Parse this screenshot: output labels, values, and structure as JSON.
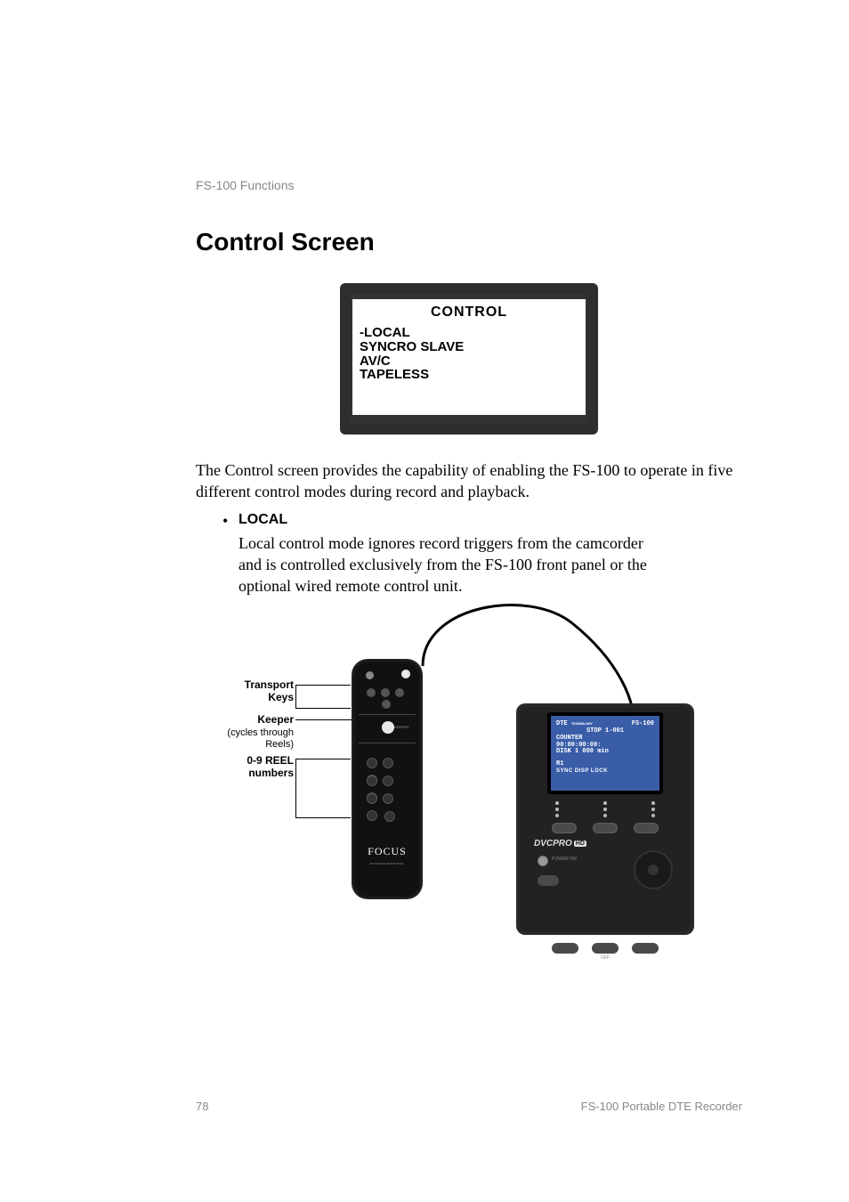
{
  "header": "FS-100 Functions",
  "title": "Control Screen",
  "lcd": {
    "title": "CONTROL",
    "lines": [
      "-LOCAL",
      " SYNCRO SLAVE",
      " AV/C",
      "TAPELESS"
    ]
  },
  "paragraph": "The Control screen provides the capability of enabling the FS-100 to operate in five different control modes during record and playback.",
  "bullet": {
    "label": "LOCAL",
    "body": "Local control mode ignores record triggers from the camcorder and is controlled exclusively from the FS-100 front panel or the optional wired remote control unit."
  },
  "callouts": {
    "transport": {
      "l1": "Transport",
      "l2": "Keys"
    },
    "keeper": {
      "l1": "Keeper",
      "l2": "(cycles through",
      "l3": "Reels)"
    },
    "reel": {
      "l1": "0-9 REEL",
      "l2": "numbers"
    }
  },
  "remote_logo": "FOCUS",
  "remote_logo_sub": "enhancements",
  "remote_keeper": "KEEPER",
  "fs100": {
    "brand": "DTE",
    "brand_sub": "TECHNOLOGY",
    "model": "FS-100",
    "status": "STOP  1-001",
    "counter_label": "COUNTER",
    "counter": "00:00:00:00:",
    "disk": "DISK 1   000 min",
    "r1": "R1",
    "softkeys": "SYNC  DISP  LOCK",
    "logo": "DVCPRO",
    "hd": "HD",
    "power": "POWER ON",
    "off": "OFF"
  },
  "footer": {
    "page": "78",
    "doc": "FS-100 Portable DTE Recorder"
  }
}
